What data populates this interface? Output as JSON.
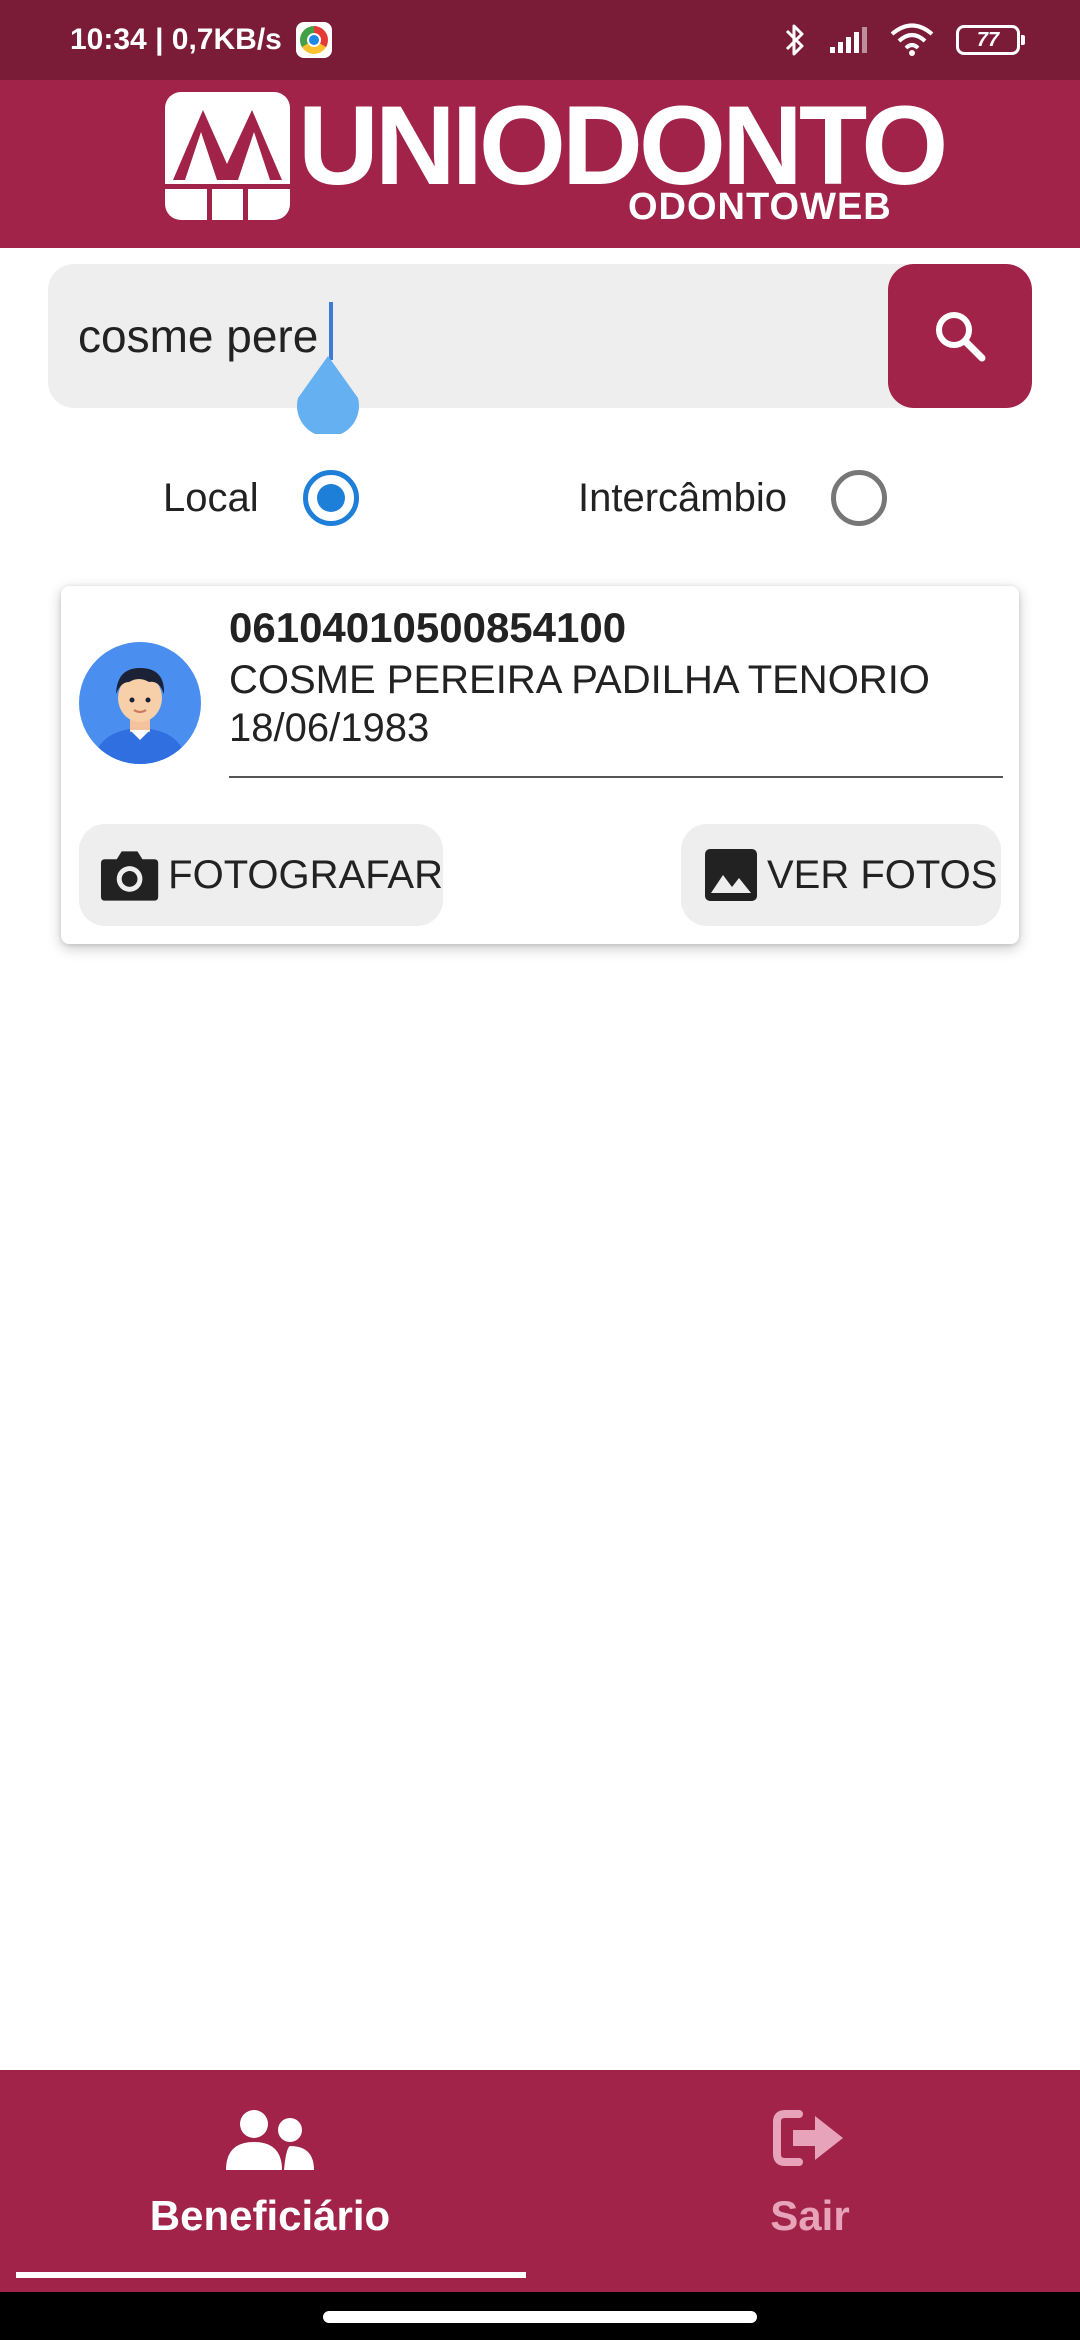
{
  "status_bar": {
    "time_speed": "10:34 | 0,7KB/s",
    "battery": "77",
    "icons": [
      "chrome-icon",
      "bluetooth-icon",
      "signal-icon",
      "wifi-icon",
      "battery-icon"
    ]
  },
  "header": {
    "logo_text": "UNIODONTO",
    "logo_subtitle": "ODONTOWEB",
    "logo_icon": "uniodonto-logo-icon"
  },
  "search": {
    "value": "cosme pere",
    "button_icon": "search-icon"
  },
  "filter": {
    "options": [
      {
        "label": "Local",
        "selected": true
      },
      {
        "label": "Intercâmbio",
        "selected": false
      }
    ]
  },
  "results": [
    {
      "code": "06104010500854100",
      "name": "COSME PEREIRA PADILHA TENORIO",
      "birth_date": "18/06/1983",
      "avatar_icon": "user-avatar-icon",
      "actions": {
        "photograph_label": "FOTOGRAFAR",
        "photograph_icon": "camera-icon",
        "view_photos_label": "VER FOTOS",
        "view_photos_icon": "image-icon"
      }
    }
  ],
  "bottom_nav": {
    "items": [
      {
        "label": "Beneficiário",
        "icon": "users-icon",
        "active": true
      },
      {
        "label": "Sair",
        "icon": "sign-out-icon",
        "active": false
      }
    ]
  },
  "colors": {
    "brand": "#a12349",
    "status_bar": "#7a1c38",
    "radio_selected": "#1e7fd8",
    "inactive_nav": "#e7a3ba"
  }
}
